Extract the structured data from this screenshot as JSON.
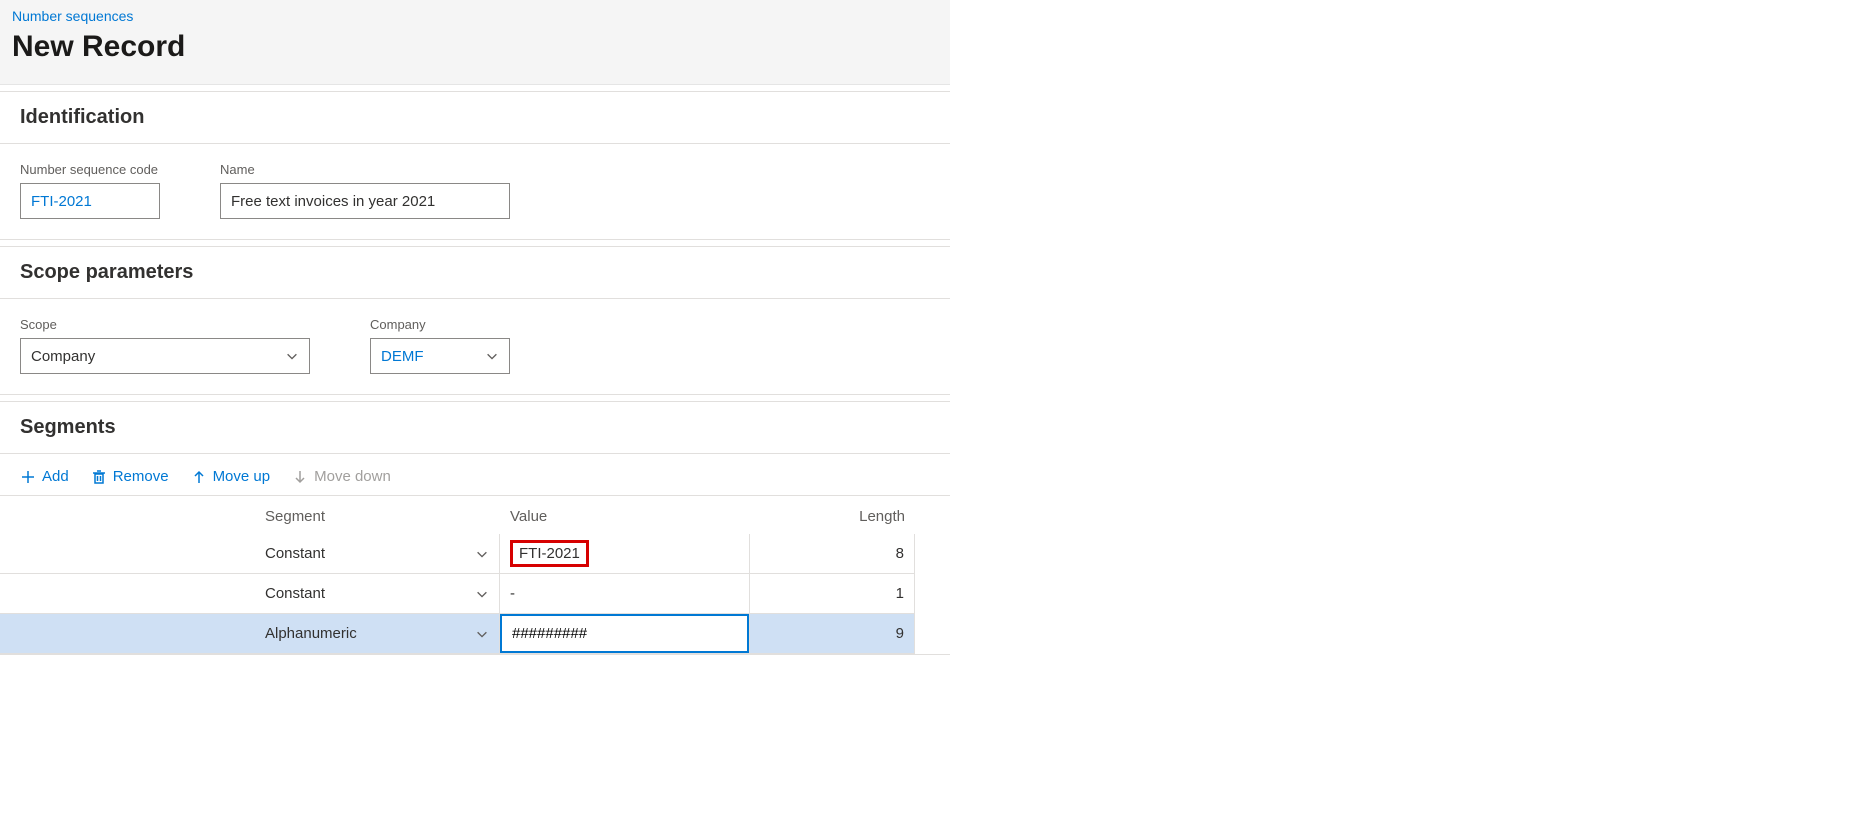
{
  "breadcrumb": "Number sequences",
  "page_title": "New Record",
  "sections": {
    "identification": {
      "title": "Identification",
      "code_label": "Number sequence code",
      "code_value": "FTI-2021",
      "name_label": "Name",
      "name_value": "Free text invoices in year 2021"
    },
    "scope": {
      "title": "Scope parameters",
      "scope_label": "Scope",
      "scope_value": "Company",
      "company_label": "Company",
      "company_value": "DEMF"
    },
    "segments": {
      "title": "Segments",
      "toolbar": {
        "add": "Add",
        "remove": "Remove",
        "moveup": "Move up",
        "movedown": "Move down"
      },
      "columns": {
        "segment": "Segment",
        "value": "Value",
        "length": "Length"
      },
      "rows": [
        {
          "segment": "Constant",
          "value": "FTI-2021",
          "length": "8",
          "highlight_value": true
        },
        {
          "segment": "Constant",
          "value": "-",
          "length": "1"
        },
        {
          "segment": "Alphanumeric",
          "value": "#########",
          "length": "9",
          "selected": true,
          "editing": true
        }
      ]
    }
  }
}
